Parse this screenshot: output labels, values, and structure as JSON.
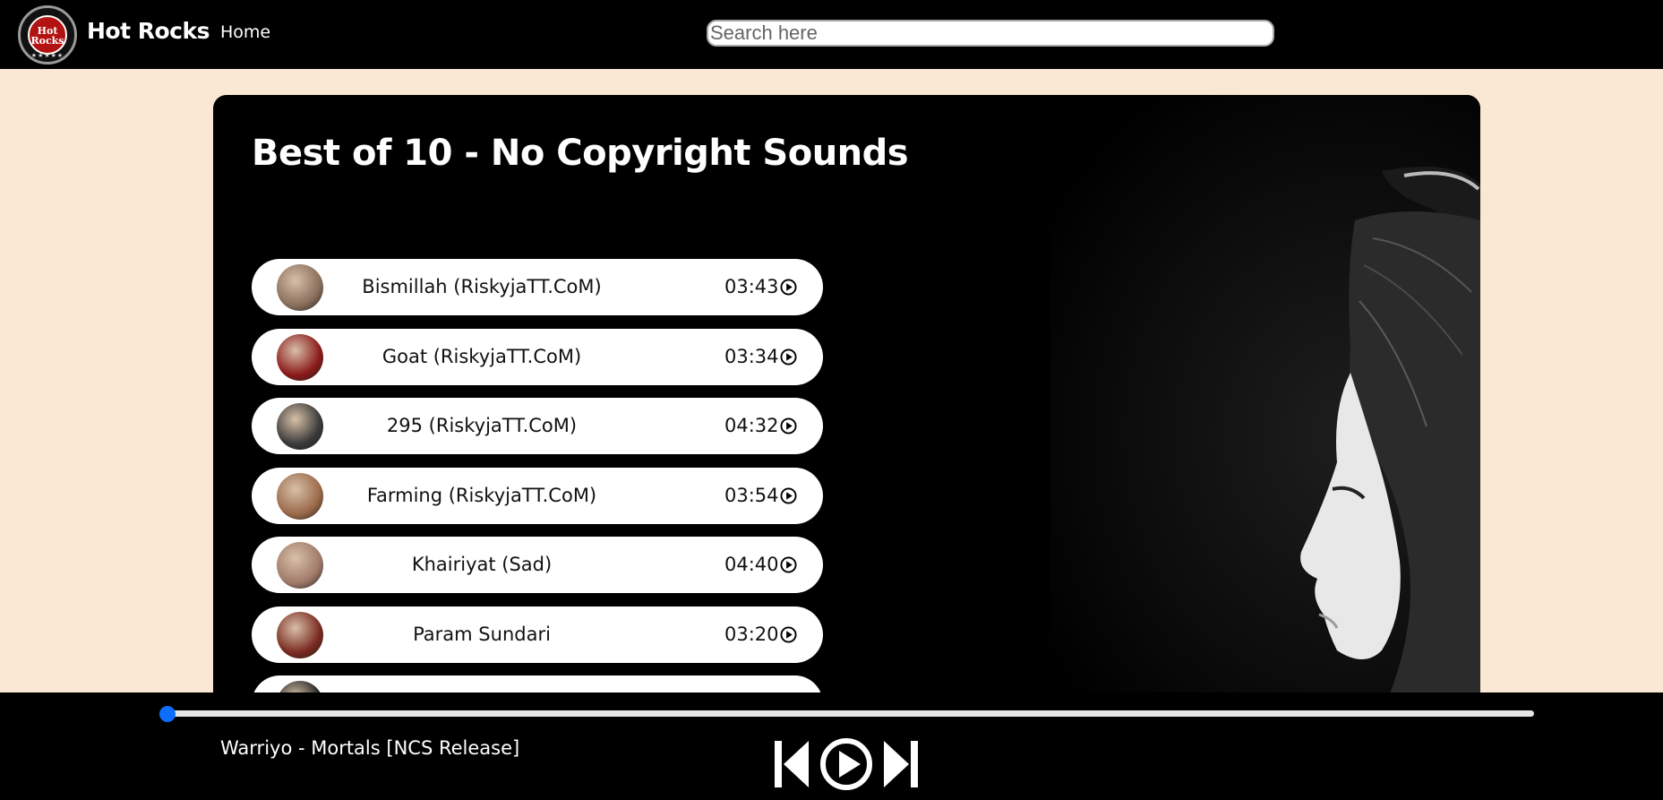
{
  "nav": {
    "logo_text_top": "Hot",
    "logo_text_bottom": "Rocks",
    "logo_ring_text": "Classic",
    "brand": "Hot Rocks",
    "home_label": "Home",
    "search_placeholder": "Search here"
  },
  "playlist": {
    "title": "Best of 10 - No Copyright Sounds",
    "songs": [
      {
        "name": "Bismillah (RiskyjaTT.CoM)",
        "duration": "03:43",
        "thumb_color": "#8a6f5c"
      },
      {
        "name": "Goat (RiskyjaTT.CoM)",
        "duration": "03:34",
        "thumb_color": "#8b1a1a"
      },
      {
        "name": "295 (RiskyjaTT.CoM)",
        "duration": "04:32",
        "thumb_color": "#3a3a3a"
      },
      {
        "name": "Farming (RiskyjaTT.CoM)",
        "duration": "03:54",
        "thumb_color": "#9b6a4a"
      },
      {
        "name": "Khairiyat (Sad)",
        "duration": "04:40",
        "thumb_color": "#a07a6a"
      },
      {
        "name": "Param Sundari",
        "duration": "03:20",
        "thumb_color": "#7a2a20"
      },
      {
        "name": "",
        "duration": "",
        "thumb_color": "#222222"
      }
    ]
  },
  "player": {
    "now_playing": "Warriyo - Mortals [NCS Release]",
    "progress": 0,
    "accent_color": "#0d6efd",
    "controls": [
      "previous-icon",
      "play-icon",
      "next-icon"
    ]
  },
  "colors": {
    "page_background": "#fae8d4",
    "panel_background": "#000000",
    "song_card": "#ffffff"
  }
}
